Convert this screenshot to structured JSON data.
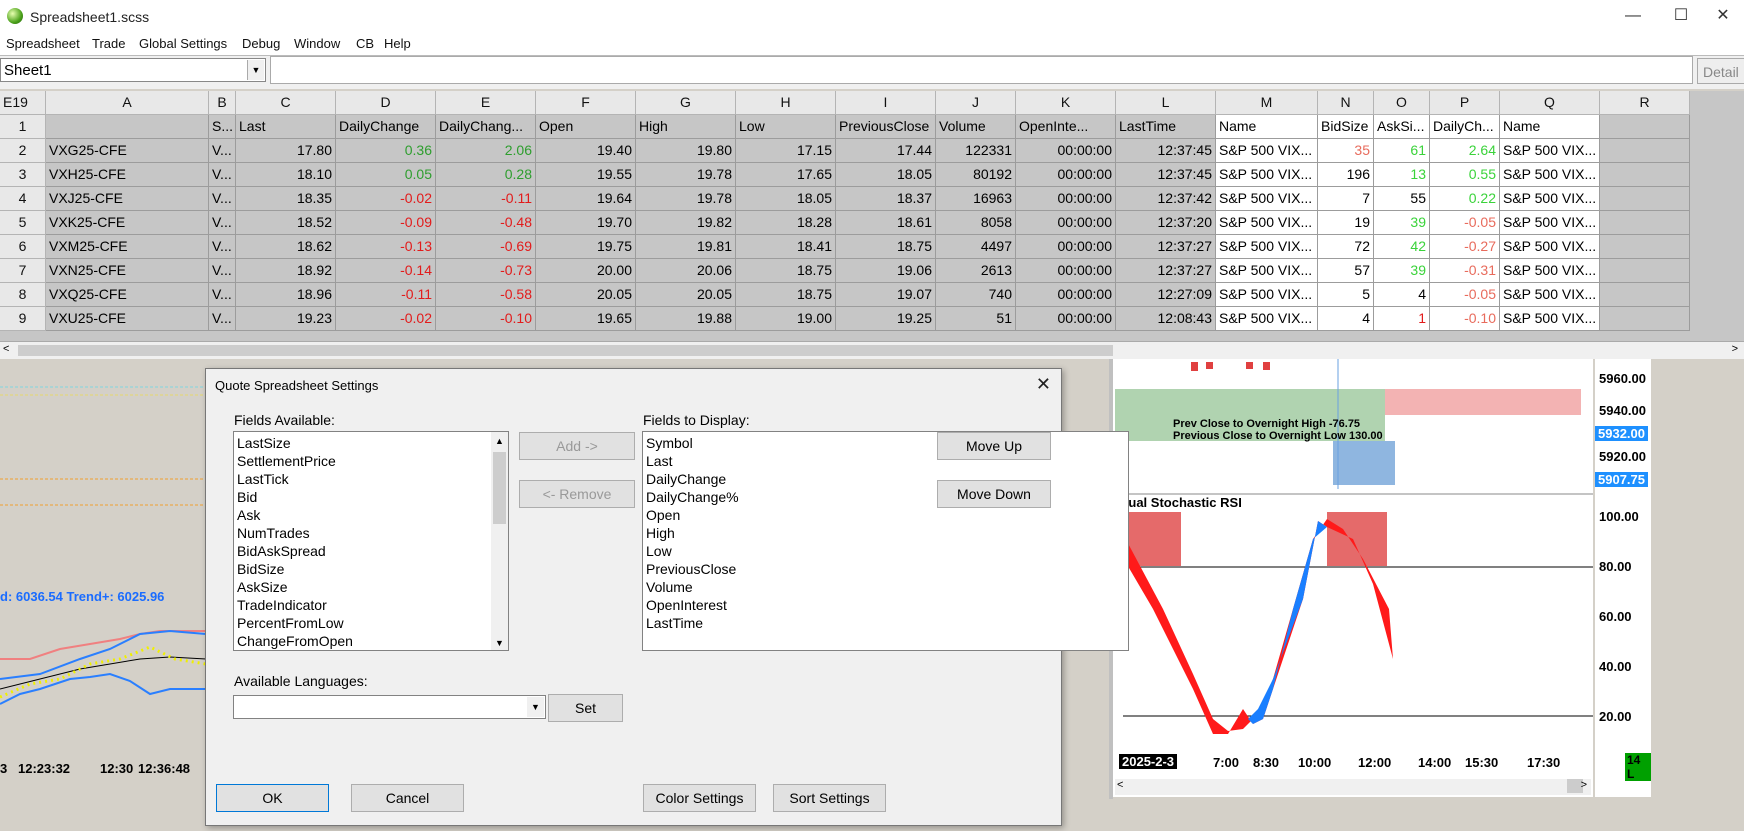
{
  "window": {
    "title": "Spreadsheet1.scss",
    "minimize": "—",
    "maximize": "☐",
    "close": "✕"
  },
  "menu": [
    "Spreadsheet",
    "Trade",
    "Global Settings",
    "Debug",
    "Window",
    "CB",
    "Help"
  ],
  "formula": {
    "sheet": "Sheet1",
    "detail": "Detail"
  },
  "grid": {
    "corner": "E19",
    "columns": [
      "A",
      "B",
      "C",
      "D",
      "E",
      "F",
      "G",
      "H",
      "I",
      "J",
      "K",
      "L",
      "M",
      "N",
      "O",
      "P",
      "Q",
      "R"
    ],
    "headers": [
      "",
      "S...",
      "Last",
      "DailyChange",
      "DailyChang...",
      "Open",
      "High",
      "Low",
      "PreviousClose",
      "Volume",
      "OpenInte...",
      "LastTime",
      "Name",
      "BidSize",
      "AskSi...",
      "DailyCh...",
      "Name",
      ""
    ],
    "rows": [
      {
        "n": "2",
        "sym": "VXG25-CFE",
        "b": "V...",
        "last": "17.80",
        "dc": "0.36",
        "dcp": "2.06",
        "open": "19.40",
        "high": "19.80",
        "low": "17.15",
        "pc": "17.44",
        "vol": "122331",
        "oi": "00:00:00",
        "lt": "12:37:45",
        "name": "S&P 500 VIX...",
        "bs": "35",
        "as": "61",
        "dc2": "2.64",
        "name2": "S&P 500 VIX..."
      },
      {
        "n": "3",
        "sym": "VXH25-CFE",
        "b": "V...",
        "last": "18.10",
        "dc": "0.05",
        "dcp": "0.28",
        "open": "19.55",
        "high": "19.78",
        "low": "17.65",
        "pc": "18.05",
        "vol": "80192",
        "oi": "00:00:00",
        "lt": "12:37:45",
        "name": "S&P 500 VIX...",
        "bs": "196",
        "as": "13",
        "dc2": "0.55",
        "name2": "S&P 500 VIX..."
      },
      {
        "n": "4",
        "sym": "VXJ25-CFE",
        "b": "V...",
        "last": "18.35",
        "dc": "-0.02",
        "dcp": "-0.11",
        "open": "19.64",
        "high": "19.78",
        "low": "18.05",
        "pc": "18.37",
        "vol": "16963",
        "oi": "00:00:00",
        "lt": "12:37:42",
        "name": "S&P 500 VIX...",
        "bs": "7",
        "as": "55",
        "dc2": "0.22",
        "name2": "S&P 500 VIX..."
      },
      {
        "n": "5",
        "sym": "VXK25-CFE",
        "b": "V...",
        "last": "18.52",
        "dc": "-0.09",
        "dcp": "-0.48",
        "open": "19.70",
        "high": "19.82",
        "low": "18.28",
        "pc": "18.61",
        "vol": "8058",
        "oi": "00:00:00",
        "lt": "12:37:20",
        "name": "S&P 500 VIX...",
        "bs": "19",
        "as": "39",
        "dc2": "-0.05",
        "name2": "S&P 500 VIX..."
      },
      {
        "n": "6",
        "sym": "VXM25-CFE",
        "b": "V...",
        "last": "18.62",
        "dc": "-0.13",
        "dcp": "-0.69",
        "open": "19.75",
        "high": "19.81",
        "low": "18.41",
        "pc": "18.75",
        "vol": "4497",
        "oi": "00:00:00",
        "lt": "12:37:27",
        "name": "S&P 500 VIX...",
        "bs": "72",
        "as": "42",
        "dc2": "-0.27",
        "name2": "S&P 500 VIX..."
      },
      {
        "n": "7",
        "sym": "VXN25-CFE",
        "b": "V...",
        "last": "18.92",
        "dc": "-0.14",
        "dcp": "-0.73",
        "open": "20.00",
        "high": "20.06",
        "low": "18.75",
        "pc": "19.06",
        "vol": "2613",
        "oi": "00:00:00",
        "lt": "12:37:27",
        "name": "S&P 500 VIX...",
        "bs": "57",
        "as": "39",
        "dc2": "-0.31",
        "name2": "S&P 500 VIX..."
      },
      {
        "n": "8",
        "sym": "VXQ25-CFE",
        "b": "V...",
        "last": "18.96",
        "dc": "-0.11",
        "dcp": "-0.58",
        "open": "20.05",
        "high": "20.05",
        "low": "18.75",
        "pc": "19.07",
        "vol": "740",
        "oi": "00:00:00",
        "lt": "12:27:09",
        "name": "S&P 500 VIX...",
        "bs": "5",
        "as": "4",
        "dc2": "-0.05",
        "name2": "S&P 500 VIX..."
      },
      {
        "n": "9",
        "sym": "VXU25-CFE",
        "b": "V...",
        "last": "19.23",
        "dc": "-0.02",
        "dcp": "-0.10",
        "open": "19.65",
        "high": "19.88",
        "low": "19.00",
        "pc": "19.25",
        "vol": "51",
        "oi": "00:00:00",
        "lt": "12:08:43",
        "name": "S&P 500 VIX...",
        "bs": "4",
        "as": "1",
        "dc2": "-0.10",
        "name2": "S&P 500 VIX..."
      }
    ]
  },
  "colors": {
    "up": "#2e9e2e",
    "down": "#e21b1b",
    "bidsize_red": "#e86b5c",
    "ask_green": "#3ad33a"
  },
  "left_chart": {
    "trend_text": "d: 6036.54  Trend+: 6025.96",
    "times": [
      "3",
      "12:23:32",
      "12:30",
      "12:36:48"
    ]
  },
  "right_chart": {
    "price_labels": [
      "5960.00",
      "5940.00",
      "5932.00",
      "5920.00",
      "5907.75"
    ],
    "annotation1": "Prev Close to Overnight High -76.75",
    "annotation2": "Previous Close to Overnight Low 130.00",
    "study_title": "Dual Stochastic RSI",
    "rsi_labels": [
      "100.00",
      "80.00",
      "60.00",
      "40.00",
      "20.00"
    ],
    "date_label": "2025-2-3",
    "times": [
      "7:00",
      "8:30",
      "10:00",
      "12:00",
      "14:00",
      "15:30",
      "17:30"
    ],
    "badge": "14 L"
  },
  "dialog": {
    "title": "Quote Spreadsheet Settings",
    "fields_available_label": "Fields Available:",
    "fields_available": [
      "LastSize",
      "SettlementPrice",
      "LastTick",
      "Bid",
      "Ask",
      "NumTrades",
      "BidAskSpread",
      "BidSize",
      "AskSize",
      "TradeIndicator",
      "PercentFromLow",
      "ChangeFromOpen"
    ],
    "fields_display_label": "Fields to Display:",
    "fields_display": [
      "Symbol",
      "Last",
      "DailyChange",
      "DailyChange%",
      "Open",
      "High",
      "Low",
      "PreviousClose",
      "Volume",
      "OpenInterest",
      "LastTime"
    ],
    "add": "Add ->",
    "remove": "<- Remove",
    "move_up": "Move Up",
    "move_down": "Move Down",
    "languages_label": "Available Languages:",
    "language_value": "",
    "set": "Set",
    "ok": "OK",
    "cancel": "Cancel",
    "color_settings": "Color Settings",
    "sort_settings": "Sort Settings"
  }
}
